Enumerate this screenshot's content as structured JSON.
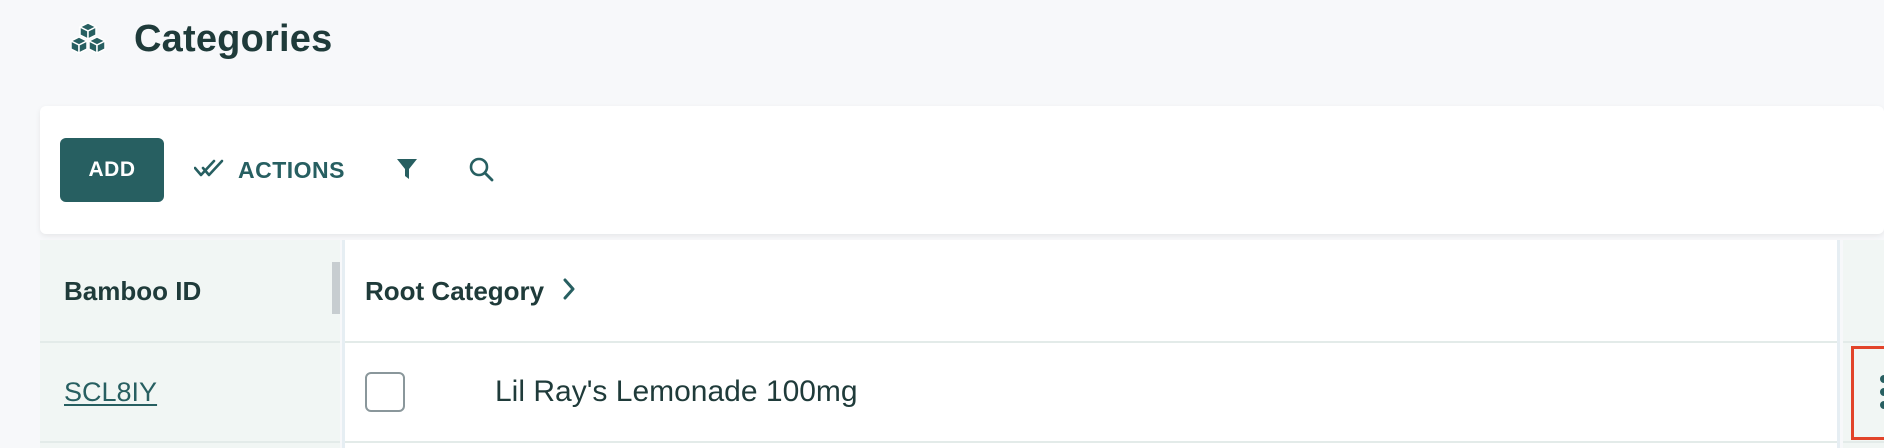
{
  "header": {
    "title": "Categories",
    "icon": "cubes-icon"
  },
  "toolbar": {
    "add_label": "ADD",
    "actions_label": "ACTIONS",
    "filter_icon": "filter-icon",
    "search_icon": "search-icon"
  },
  "table": {
    "columns": [
      "Bamboo ID",
      "Root Category"
    ],
    "rows": [
      {
        "id": "SCL8IY",
        "name": "Lil Ray's Lemonade 100mg",
        "checked": false
      }
    ]
  },
  "colors": {
    "accent": "#275f61",
    "text": "#1f3b3a",
    "highlight": "#e2442a",
    "background": "#f7f8fa"
  }
}
